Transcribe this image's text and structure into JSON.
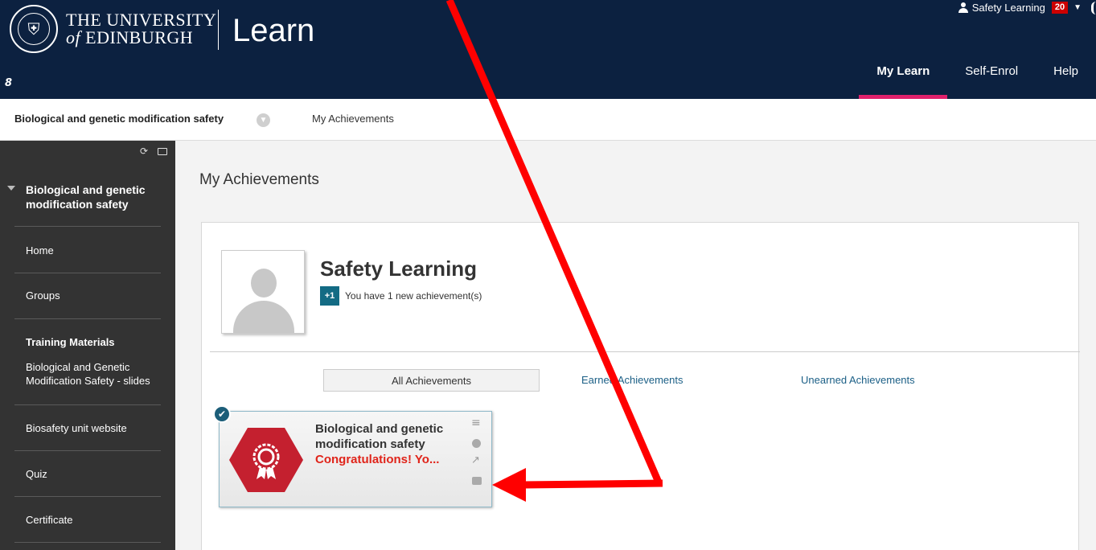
{
  "header": {
    "university_line1": "THE UNIVERSITY",
    "university_of": "of",
    "university_line2": "EDINBURGH",
    "brand": "Learn",
    "user_name": "Safety Learning",
    "notification_count": "20",
    "nav": [
      {
        "label": "My Learn",
        "active": true
      },
      {
        "label": "Self-Enrol",
        "active": false
      },
      {
        "label": "Help",
        "active": false
      }
    ],
    "link_glyph": "8"
  },
  "breadcrumb": {
    "course": "Biological and genetic modification safety",
    "page": "My Achievements"
  },
  "sidebar": {
    "course_title": "Biological and genetic modification safety",
    "items": {
      "home": "Home",
      "groups": "Groups",
      "training_heading": "Training Materials",
      "training_slides": "Biological and Genetic Modification Safety - slides",
      "biosafety": "Biosafety unit website",
      "quiz": "Quiz",
      "certificate": "Certificate"
    }
  },
  "main": {
    "page_title": "My Achievements",
    "profile": {
      "name": "Safety Learning",
      "new_badge": "+1",
      "new_text": "You have 1 new achievement(s)"
    },
    "tabs": {
      "all": "All Achievements",
      "earned": "Earned Achievements",
      "unearned": "Unearned Achievements"
    },
    "achievement": {
      "title": "Biological and genetic modification safety",
      "message": "Congratulations! Yo...",
      "badge_color": "#c4202f"
    }
  },
  "colors": {
    "header_bg": "#0c2140",
    "nav_active_underline": "#e0206b",
    "sidebar_bg": "#333333",
    "link": "#1b5f86",
    "annotation_arrow": "#ff0000"
  }
}
